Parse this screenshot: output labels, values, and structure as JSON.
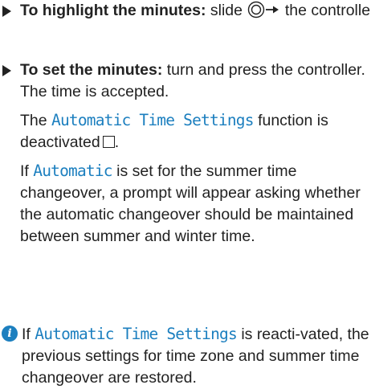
{
  "steps": [
    {
      "bold": "To highlight the minutes:",
      "text_a": "slide",
      "text_b": "the controller."
    },
    {
      "bold": "To set the minutes:",
      "text": "turn and press the controller.",
      "result": "The time is accepted.",
      "deactivated_prefix": "The",
      "deactivated_display": "Automatic Time Settings",
      "deactivated_suffix": "function is deactivated",
      "summer_prefix": "If",
      "summer_display": "Automatic",
      "summer_suffix": "is set for the summer time changeover, a prompt will appear asking whether the automatic changeover should be maintained between summer and winter time."
    }
  ],
  "note": {
    "icon": "info-icon",
    "prefix": "If",
    "display": "Automatic Time Settings",
    "suffix": "is reacti-vated, the previous settings for time zone and summer time changeover are restored."
  },
  "colors": {
    "display_text": "#1c7fbf",
    "body_text": "#222222"
  }
}
